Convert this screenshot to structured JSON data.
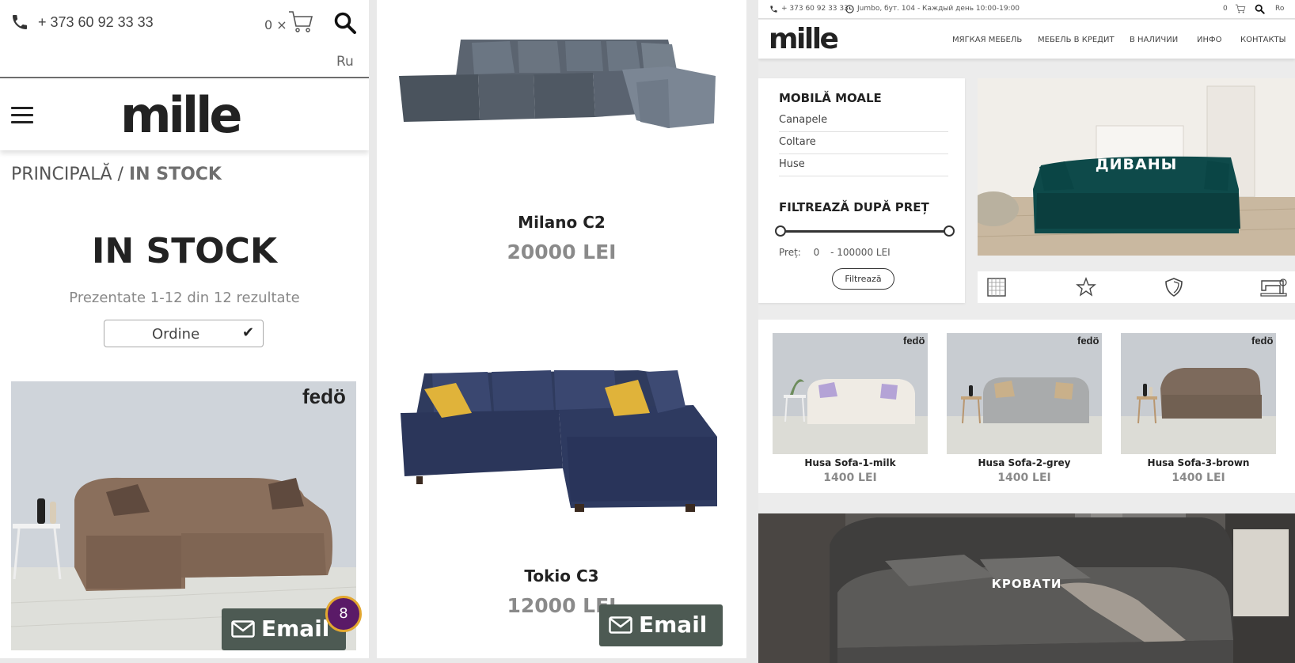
{
  "mobile": {
    "phone": "+ 373 60 92 33 33",
    "cart_count": "0 ×",
    "language": "Ru",
    "logo": "mille",
    "breadcrumb_home": "PRINCIPALĂ /",
    "breadcrumb_current": "IN STOCK",
    "title": "IN STOCK",
    "results": "Prezentate 1-12 din 12 rezultate",
    "order_label": "Ordine",
    "order_check": "✔",
    "product_brand": "fedö",
    "email_label": "Email",
    "badge_count": "8"
  },
  "listing": {
    "products": [
      {
        "name": "Milano C2",
        "price": "20000 LEI"
      },
      {
        "name": "Tokio C3",
        "price": "12000 LEI"
      }
    ],
    "email_label": "Email"
  },
  "desktop": {
    "topbar": {
      "phone": "+ 373 60 92 33 33",
      "address": "Jumbo, бут. 104 - Каждый день 10:00-19:00",
      "cart_count": "0",
      "language": "Ro"
    },
    "logo": "mille",
    "nav": [
      "МЯГКАЯ МЕБЕЛЬ",
      "МЕБЕЛЬ В КРЕДИТ",
      "В НАЛИЧИИ",
      "ИНФО",
      "КОНТАКТЫ"
    ],
    "sidebar": {
      "heading": "MOBILĂ MOALE",
      "items": [
        "Canapele",
        "Coltare",
        "Huse"
      ],
      "filter_heading": "FILTREAZĂ DUPĂ PREȚ",
      "price_label": "Preț:",
      "price_min": "0",
      "price_max": "- 100000 LEI",
      "filter_button": "Filtrează"
    },
    "hero_sofas": "ДИВАНЫ",
    "hero_beds": "КРОВАТИ",
    "feature_icons": [
      "fabric-icon",
      "star-icon",
      "shield-icon",
      "sewing-machine-icon"
    ],
    "products": [
      {
        "name": "Husa Sofa-1-milk",
        "price": "1400 LEI",
        "brand": "fedö"
      },
      {
        "name": "Husa Sofa-2-grey",
        "price": "1400 LEI",
        "brand": "fedö"
      },
      {
        "name": "Husa Sofa-3-brown",
        "price": "1400 LEI",
        "brand": "fedö"
      }
    ]
  },
  "colors": {
    "email_button": "#4d5a53",
    "badge": "#5a1a67",
    "sofa_green": "#0e4a4a",
    "price_grey": "#8a8a8a"
  }
}
